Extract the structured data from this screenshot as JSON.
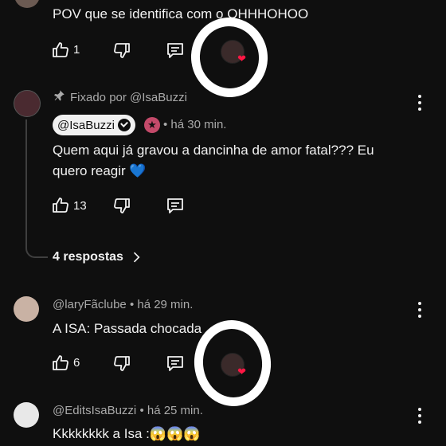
{
  "comment0": {
    "text": "POV que se identifica com o OHHHOHOO",
    "likes": "1"
  },
  "pinned": {
    "pinned_label": "Fixado por @IsaBuzzi",
    "author": "@IsaBuzzi",
    "time": "• há 30 min.",
    "text_line1": "Quem aqui já gravou a dancinha de amor fatal??? Eu",
    "text_line2": "quero reagir",
    "emoji": "💙",
    "likes": "13",
    "replies": "4 respostas"
  },
  "comment2": {
    "author": "@laryFãclube",
    "time": "• há 29 min.",
    "text": "A ISA: Passada chocada",
    "likes": "6"
  },
  "comment3": {
    "author": "@EditsIsaBuzzi",
    "time": "• há 25 min.",
    "text": "Kkkkkkkk a Isa :😱😱😱"
  },
  "colors": {
    "background": "#0f0f0f",
    "text": "#f1f1f1",
    "meta": "#aaaaaa",
    "heart": "#ff1744",
    "annotation": "#ffffff"
  },
  "icons": [
    "like-icon",
    "dislike-icon",
    "reply-icon",
    "creator-heart-icon",
    "pin-icon",
    "verified-icon",
    "more-vert-icon",
    "chevron-right-icon"
  ]
}
